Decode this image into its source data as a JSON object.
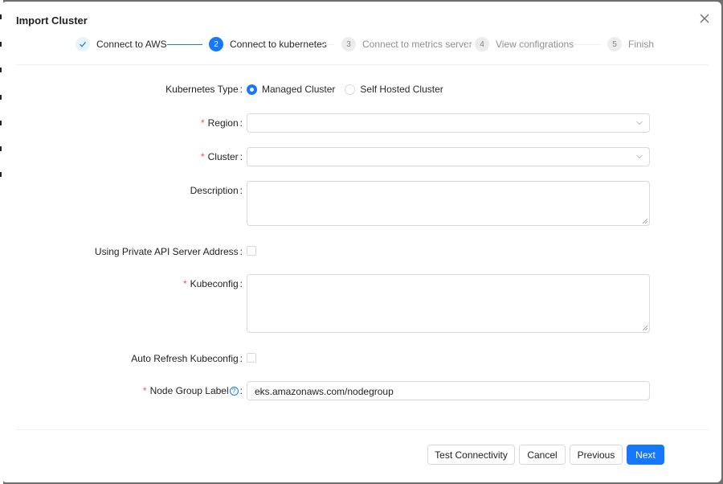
{
  "modal": {
    "title": "Import Cluster"
  },
  "steps": [
    {
      "number": "",
      "label": "Connect to AWS",
      "status": "finished"
    },
    {
      "number": "2",
      "label": "Connect to kubernetes",
      "status": "active"
    },
    {
      "number": "3",
      "label": "Connect to metrics server",
      "status": "wait"
    },
    {
      "number": "4",
      "label": "View configrations",
      "status": "wait"
    },
    {
      "number": "5",
      "label": "Finish",
      "status": "wait"
    }
  ],
  "form": {
    "kubernetes_type": {
      "label": "Kubernetes Type",
      "options": [
        {
          "label": "Managed Cluster",
          "checked": true
        },
        {
          "label": "Self Hosted Cluster",
          "checked": false
        }
      ]
    },
    "region": {
      "label": "Region",
      "required": true,
      "value": ""
    },
    "cluster": {
      "label": "Cluster",
      "required": true,
      "value": ""
    },
    "description": {
      "label": "Description",
      "value": ""
    },
    "private_api": {
      "label": "Using Private API Server Address",
      "checked": false
    },
    "kubeconfig": {
      "label": "Kubeconfig",
      "required": true,
      "value": ""
    },
    "auto_refresh": {
      "label": "Auto Refresh Kubeconfig",
      "checked": false
    },
    "node_group_label": {
      "label": "Node Group Label",
      "required": true,
      "value": "eks.amazonaws.com/nodegroup"
    },
    "colon": ":",
    "required_mark": "*"
  },
  "footer": {
    "test_connectivity": "Test Connectivity",
    "cancel": "Cancel",
    "previous": "Previous",
    "next": "Next"
  },
  "icons": {
    "close": "close-icon",
    "check": "check-icon",
    "chevron": "chevron-down-icon",
    "help": "question-circle-icon"
  },
  "colors": {
    "primary": "#1677ff",
    "required": "#ff4d4f",
    "border": "#d9d9d9"
  }
}
